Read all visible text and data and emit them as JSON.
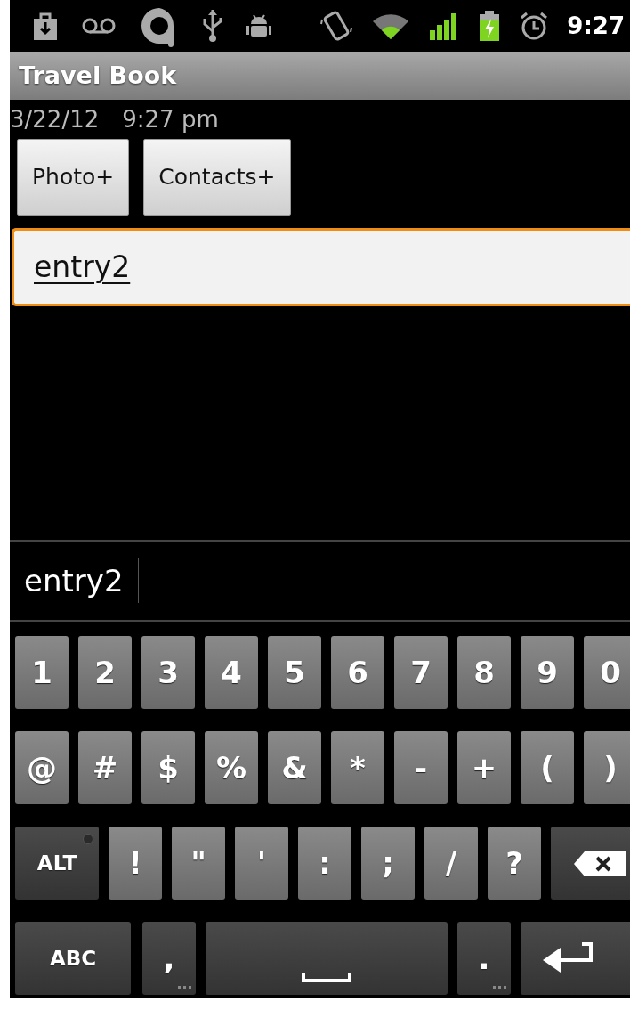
{
  "status_bar": {
    "time": "9:27"
  },
  "title_bar": {
    "title": "Travel Book"
  },
  "date": "3/22/12",
  "time": "9:27 pm",
  "buttons": [
    "Photo+",
    "Contacts+"
  ],
  "entry_field": {
    "value": "entry2",
    "focused": true
  },
  "suggestion": {
    "text": "entry2"
  },
  "keyboard": {
    "number_keys": [
      {
        "kind": "char",
        "label": "1"
      },
      {
        "kind": "char",
        "label": "2"
      },
      {
        "kind": "char",
        "label": "3"
      },
      {
        "kind": "char",
        "label": "4"
      },
      {
        "kind": "char",
        "label": "5"
      },
      {
        "kind": "char",
        "label": "6"
      },
      {
        "kind": "char",
        "label": "7"
      },
      {
        "kind": "char",
        "label": "8"
      },
      {
        "kind": "char",
        "label": "9"
      },
      {
        "kind": "char",
        "label": "0"
      }
    ],
    "symbol_keys": [
      {
        "kind": "char",
        "label": "@"
      },
      {
        "kind": "char",
        "label": "#"
      },
      {
        "kind": "char",
        "label": "$"
      },
      {
        "kind": "char",
        "label": "%"
      },
      {
        "kind": "char",
        "label": "&"
      },
      {
        "kind": "char",
        "label": "*"
      },
      {
        "kind": "char",
        "label": "-"
      },
      {
        "kind": "char",
        "label": "+"
      },
      {
        "kind": "char",
        "label": "("
      },
      {
        "kind": "char",
        "label": ")"
      }
    ],
    "punctuation_keys": [
      {
        "kind": "alt",
        "label": "ALT",
        "on": false
      },
      {
        "kind": "char",
        "label": "!"
      },
      {
        "kind": "char",
        "label": "\""
      },
      {
        "kind": "char",
        "label": "'"
      },
      {
        "kind": "char",
        "label": ":"
      },
      {
        "kind": "char",
        "label": ";"
      },
      {
        "kind": "char",
        "label": "/"
      },
      {
        "kind": "char",
        "label": "?"
      },
      {
        "kind": "backspace"
      }
    ],
    "bottom_keys": [
      {
        "kind": "abc",
        "label": "ABC"
      },
      {
        "kind": "punct",
        "label": ","
      },
      {
        "kind": "space"
      },
      {
        "kind": "punct",
        "label": "."
      },
      {
        "kind": "enter"
      }
    ]
  }
}
